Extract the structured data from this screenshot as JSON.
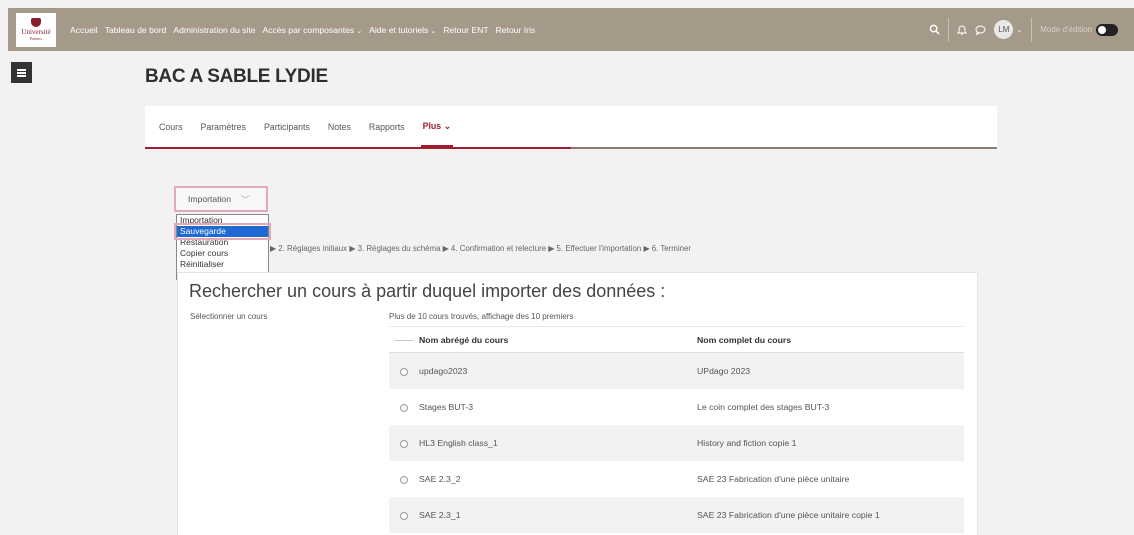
{
  "navbar": {
    "logo": {
      "line1": "Université",
      "line2": "Poitiers"
    },
    "links": [
      {
        "label": "Accueil",
        "dropdown": false
      },
      {
        "label": "Tableau de bord",
        "dropdown": false
      },
      {
        "label": "Administration du site",
        "dropdown": false
      },
      {
        "label": "Accès par composantes",
        "dropdown": true
      },
      {
        "label": "Aide et tutoriels",
        "dropdown": true
      },
      {
        "label": "Retour ENT",
        "dropdown": false
      },
      {
        "label": "Retour Iris",
        "dropdown": false
      }
    ],
    "avatar_initials": "LM",
    "edit_mode_label": "Mode d'édition",
    "edit_mode_on": false
  },
  "course": {
    "title": "BAC A SABLE LYDIE"
  },
  "secondary_nav": {
    "items": [
      {
        "label": "Cours",
        "active": false
      },
      {
        "label": "Paramètres",
        "active": false
      },
      {
        "label": "Participants",
        "active": false
      },
      {
        "label": "Notes",
        "active": false
      },
      {
        "label": "Rapports",
        "active": false
      },
      {
        "label": "Plus ⌄",
        "active": true
      }
    ]
  },
  "tertiary_select": {
    "value": "Importation",
    "options": [
      "Importation",
      "Sauvegarde",
      "Restauration",
      "Copier cours",
      "Réinitialiser"
    ],
    "highlighted": "Sauvegarde"
  },
  "steps": "▶ 2. Réglages initiaux ▶ 3. Réglages du schéma ▶ 4. Confirmation et relecture ▶ 5. Effectuer l'importation ▶ 6. Terminer",
  "search": {
    "heading": "Rechercher un cours à partir duquel importer des données :",
    "select_label": "Sélectionner un cours",
    "found_text": "Plus de 10 cours trouvés, affichage des 10 premiers",
    "columns": {
      "short": "Nom abrégé du cours",
      "full": "Nom complet du cours"
    },
    "rows": [
      {
        "short": "updago2023",
        "full": "UPdago 2023"
      },
      {
        "short": "Stages BUT-3",
        "full": "Le coin complet des stages BUT-3"
      },
      {
        "short": "HL3 English class_1",
        "full": "History and fiction copie 1"
      },
      {
        "short": "SAE 2.3_2",
        "full": "SAE 23 Fabrication d'une pièce unitaire"
      },
      {
        "short": "SAE 2.3_1",
        "full": "SAE 23 Fabrication d'une pièce unitaire copie 1"
      }
    ]
  },
  "colors": {
    "navbar": "#a59a8a",
    "accent": "#a01c2e",
    "selected_option": "#1e69d2"
  },
  "icons": [
    "search-icon",
    "bell-icon",
    "chat-icon",
    "drawer-toggle-icon"
  ]
}
